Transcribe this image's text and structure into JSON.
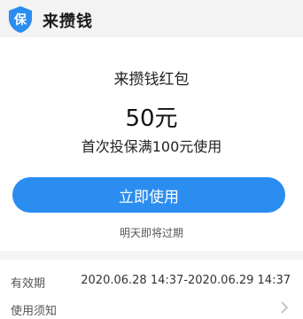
{
  "header": {
    "logo_glyph": "保",
    "brand": "来攒钱",
    "brand_color": "#2b8df0"
  },
  "coupon": {
    "title": "来攒钱红包",
    "amount": "50元",
    "condition": "首次投保满100元使用",
    "button_label": "立即使用",
    "expire_note": "明天即将过期"
  },
  "details": {
    "validity_label": "有效期",
    "validity_value": "2020.06.28 14:37-2020.06.29 14:37",
    "notice_label": "使用须知",
    "notice_icon": "chevron-right-icon"
  }
}
